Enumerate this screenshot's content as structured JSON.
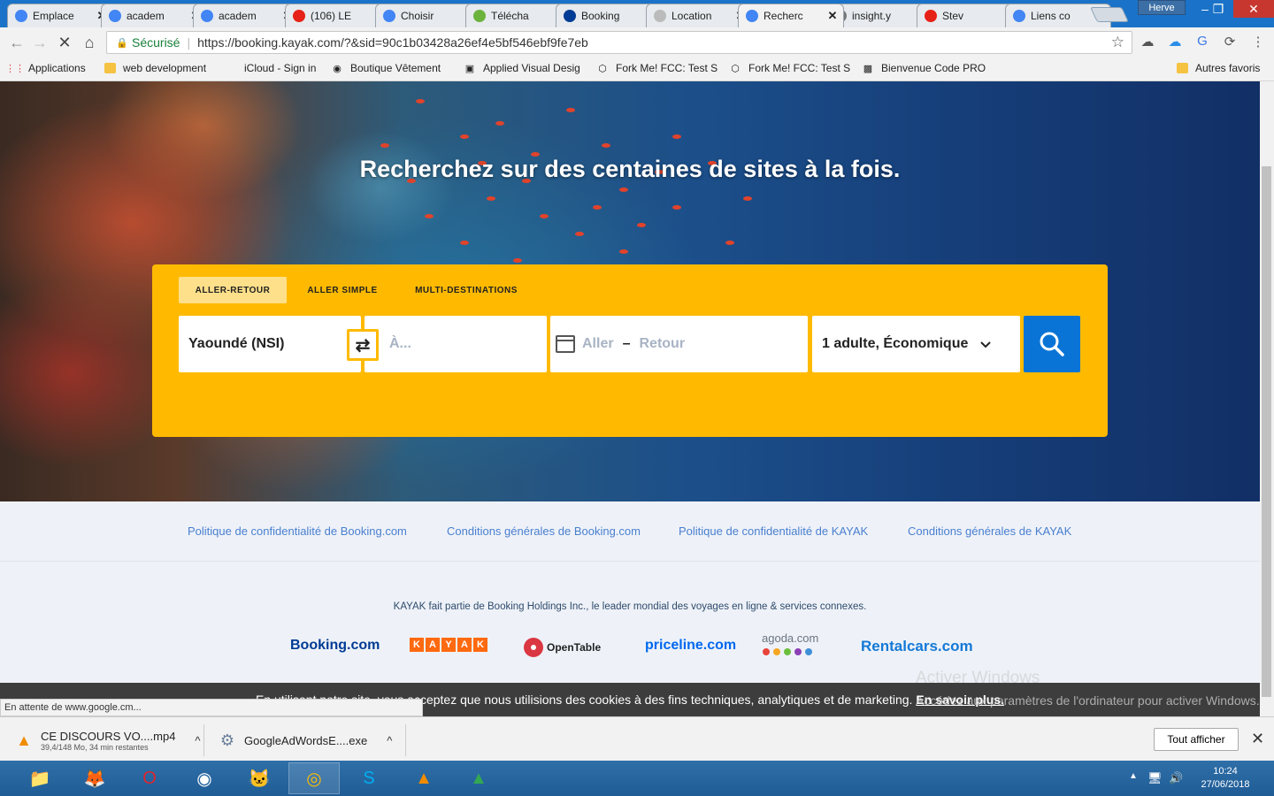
{
  "browser": {
    "tabs": [
      {
        "label": "Emplace",
        "icon": "google-icon",
        "color": "#4285f4"
      },
      {
        "label": "academ",
        "icon": "google-icon",
        "color": "#4285f4"
      },
      {
        "label": "academ",
        "icon": "google-icon",
        "color": "#4285f4"
      },
      {
        "label": "(106) LE",
        "icon": "youtube-icon",
        "color": "#e62117"
      },
      {
        "label": "Choisir",
        "icon": "google-icon",
        "color": "#4285f4"
      },
      {
        "label": "Télécha",
        "icon": "download-arrow-icon",
        "color": "#6cb33e"
      },
      {
        "label": "Booking",
        "icon": "booking-icon",
        "color": "#003b95"
      },
      {
        "label": "Location",
        "icon": "blank-page-icon",
        "color": "#bbbbbb"
      },
      {
        "label": "Recherc",
        "icon": "loading-spinner-icon",
        "color": "#4285f4"
      },
      {
        "label": "insight.y",
        "icon": "gear-icon",
        "color": "#777777"
      },
      {
        "label": "Stev",
        "icon": "youtube-icon",
        "color": "#e62117"
      },
      {
        "label": "Liens co",
        "icon": "google-icon",
        "color": "#4285f4"
      }
    ],
    "profile_name": "Herve",
    "secure_label": "Sécurisé",
    "url": "https://booking.kayak.com/?&sid=90c1b03428a26ef4e5bf546ebf9fe7eb",
    "bookmarks": [
      {
        "label": "Applications",
        "icon": "apps-grid-icon"
      },
      {
        "label": "web development",
        "icon": "folder-icon"
      },
      {
        "label": "iCloud - Sign in",
        "icon": "apple-icon"
      },
      {
        "label": "Boutique Vêtement",
        "icon": "camera-icon"
      },
      {
        "label": "Applied Visual Desig",
        "icon": "fcc-icon"
      },
      {
        "label": "Fork Me! FCC: Test S",
        "icon": "codepen-icon"
      },
      {
        "label": "Fork Me! FCC: Test S",
        "icon": "codepen-icon"
      },
      {
        "label": "Bienvenue Code PRO",
        "icon": "codepro-icon"
      },
      {
        "label": "Autres favoris",
        "icon": "folder-icon"
      }
    ],
    "status_text": "En attente de www.google.cm..."
  },
  "page": {
    "hero_title": "Recherchez sur des centaines de sites à la fois.",
    "trip_tabs": [
      "ALLER-RETOUR",
      "ALLER SIMPLE",
      "MULTI-DESTINATIONS"
    ],
    "selected_trip_tab": "ALLER-RETOUR",
    "origin_value": "Yaoundé (NSI)",
    "destination_placeholder": "À...",
    "depart_placeholder": "Aller",
    "return_placeholder": "Retour",
    "date_separator": "–",
    "passengers_value": "1 adulte, Économique",
    "legal_links": [
      "Politique de confidentialité de Booking.com",
      "Conditions générales de Booking.com",
      "Politique de confidentialité de KAYAK",
      "Conditions générales de KAYAK"
    ],
    "footer_text": "KAYAK fait partie de Booking Holdings Inc., le leader mondial des voyages en ligne & services connexes.",
    "brands": {
      "booking": "Booking.com",
      "kayak_letters": [
        "K",
        "A",
        "Y",
        "A",
        "K"
      ],
      "opentable": "OpenTable",
      "priceline": "priceline.com",
      "agoda": "agoda.com",
      "rentalcars": "Rentalcars.com"
    },
    "cookie_text": "En utilisant notre site, vous acceptez que nous utilisions des cookies à des fins techniques, analytiques et de marketing.",
    "cookie_link": "En savoir plus.",
    "windows_watermark_title": "Activer Windows",
    "windows_watermark_text": "Accédez aux paramètres de l'ordinateur pour activer Windows.",
    "colors": {
      "accent": "#ffba00",
      "search_button": "#0a74d6",
      "link": "#4a7fcf"
    }
  },
  "downloads": [
    {
      "name": "CE DISCOURS VO....mp4",
      "sub": "39,4/148 Mo, 34 min restantes",
      "icon": "vlc-cone-icon"
    },
    {
      "name": "GoogleAdWordsE....exe",
      "sub": "",
      "icon": "installer-icon"
    }
  ],
  "downloads_show_all": "Tout afficher",
  "taskbar": {
    "apps": [
      "file-explorer-icon",
      "firefox-icon",
      "opera-icon",
      "firefox-dev-icon",
      "cat-app-icon",
      "chrome-icon",
      "skype-icon",
      "vlc-icon",
      "adwords-icon"
    ],
    "time": "10:24",
    "date": "27/06/2018"
  }
}
